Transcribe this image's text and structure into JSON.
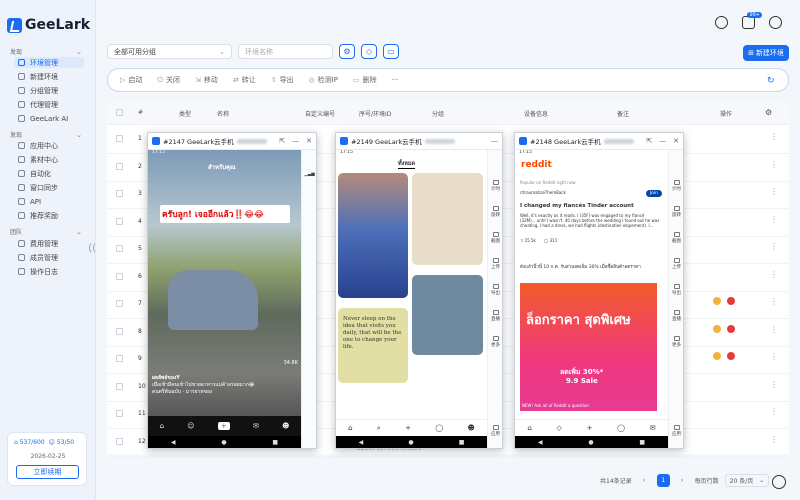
{
  "brand": {
    "name": "GeeLark"
  },
  "sidebar": {
    "sections": [
      {
        "label": "发现"
      },
      {
        "label": "发现"
      },
      {
        "label": "团队"
      }
    ],
    "items": [
      {
        "label": "环境管理",
        "active": true
      },
      {
        "label": "新建环境"
      },
      {
        "label": "分组管理"
      },
      {
        "label": "代理管理"
      },
      {
        "label": "GeeLark AI"
      },
      {
        "label": "应用中心"
      },
      {
        "label": "素材中心"
      },
      {
        "label": "自动化"
      },
      {
        "label": "窗口同步"
      },
      {
        "label": "API"
      },
      {
        "label": "推荐奖励"
      },
      {
        "label": "费用管理"
      },
      {
        "label": "成员管理"
      },
      {
        "label": "操作日志"
      }
    ],
    "account": {
      "stat1": "537/600",
      "stat2": "53/50",
      "date": "2026-02-25",
      "renew_label": "立即续期"
    }
  },
  "topbar": {
    "badge": "99+"
  },
  "filters": {
    "group_select": "全部可用分组",
    "name_placeholder": "环境名称",
    "new_button": "新建环境"
  },
  "actions": [
    "启动",
    "关闭",
    "移动",
    "转让",
    "导出",
    "检测IP",
    "删除",
    "···"
  ],
  "table": {
    "headers": [
      "#",
      "类型",
      "名称",
      "自定义编号",
      "序号/环境ID",
      "分组",
      "设备信息",
      "备注",
      "操作"
    ],
    "rows": [
      {
        "num": "1"
      },
      {
        "num": "2"
      },
      {
        "num": "3"
      },
      {
        "num": "4"
      },
      {
        "num": "5"
      },
      {
        "num": "6"
      },
      {
        "num": "7"
      },
      {
        "num": "8"
      },
      {
        "num": "9"
      },
      {
        "num": "10"
      },
      {
        "num": "11"
      },
      {
        "num": "12"
      }
    ],
    "partial_id": "52167607900466600"
  },
  "pagination": {
    "total": "共14条记录",
    "current": "1",
    "per_page_label": "每页行数",
    "per_page": "20 条/页"
  },
  "phones": [
    {
      "title": "#2147 GeeLark云手机",
      "time": "17:15",
      "caption": "ครับลูก! เจออีกแล้ว‼️😂😂",
      "user": "ผลลัพธ์ของY",
      "desc": "เมื่อเช้ามีคนเข้าไปขายอาหารแม่ค้าอร่อยมาก😂",
      "music": "ดนตรีต้นฉบับ · มารยาทของ",
      "header": "สำหรับคุณ",
      "count": "34.8K"
    },
    {
      "title": "#2149 GeeLark云手机",
      "time": "17:15",
      "header": "ทั้งหมด",
      "quote": "Never sleep on the idea that visits you daily, that will be the one to change your life."
    },
    {
      "title": "#2148 GeeLark云手机",
      "time": "17:15",
      "app": "reddit",
      "popular": "Popular on Reddit right now",
      "sub": "r/traumatizeThemBack",
      "post_title": "I changed my fiancés Tinder account",
      "join": "Join",
      "post_body": "Well, it's exactly as it reads. I (35F) was engaged to my fiancé (32M)... until I wasn't. 40 days before the wedding I found out he was cheating. I had a dress, we had flights (destination elopement). I...",
      "votes": "15.5k",
      "comments": "311",
      "promo": "ดังแล้วนิ้วนี้ 10 ก.ค. รับส่วนลดเพิ่ม 30% เมื่อซื้อสินค้าลดราคา",
      "ad_title": "ล็อกราคา สุดพิเศษ",
      "ad_sub": "ลดเพิ่ม 30%*",
      "ad_date": "9.9 Sale",
      "ad_bottom": "NEW! Ask all of Reddit a question"
    }
  ],
  "side_controls": [
    "计时",
    "旋转",
    "截图",
    "上传",
    "导出",
    "直播",
    "更多",
    "应用"
  ]
}
